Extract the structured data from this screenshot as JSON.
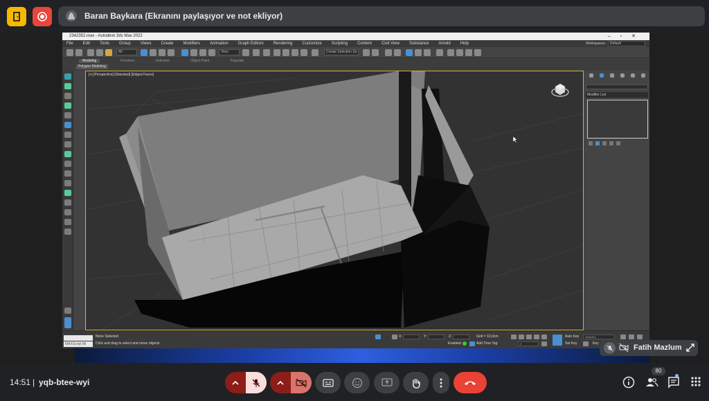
{
  "meet": {
    "presenter_banner": "Baran Baykara (Ekranını paylaşıyor ve not ekliyor)",
    "self_name": "Fatih Mazlum",
    "clock": "14:51",
    "separator": "|",
    "meeting_code": "yqb-btee-wyi",
    "participants_count": "80",
    "accent_red": "#ea4335",
    "accent_yellow": "#f5b700"
  },
  "max": {
    "title": "2342352.max - Autodesk 3ds Max 2022",
    "menu": [
      "File",
      "Edit",
      "Tools",
      "Group",
      "Views",
      "Create",
      "Modifiers",
      "Animation",
      "Graph Editors",
      "Rendering",
      "Customize",
      "Scripting",
      "Content",
      "Civil View",
      "Substance",
      "Arnold",
      "Help"
    ],
    "workspace_label": "Workspaces:",
    "workspace_value": "Default",
    "selection_filter": "All",
    "ref_coord": "View",
    "selection_set": "Create Selection Se",
    "ribbon_tabs": [
      "Modeling",
      "Freeform",
      "Selection",
      "Object Paint",
      "Populate"
    ],
    "ribbon_sub": "Polygon Modeling",
    "viewport_label": "[+] [Perspective] [Standard] [Edged Faces]",
    "modifier_list": "Modifier List",
    "status_selected": "None Selected",
    "status_prompt": "Click and drag to select and move objects",
    "maxscript": "MAXScript Mi",
    "coord_x_label": "X:",
    "coord_y_label": "Y:",
    "coord_z_label": "Z:",
    "grid": "Grid = 10,0cm",
    "enabled": "Enabled:",
    "add_time_tag": "Add Time Tag",
    "auto_key": "Auto Key",
    "set_key": "Set Key",
    "key_filter_selected": "Selected",
    "key_filters": "Key",
    "frame_value": "0"
  }
}
